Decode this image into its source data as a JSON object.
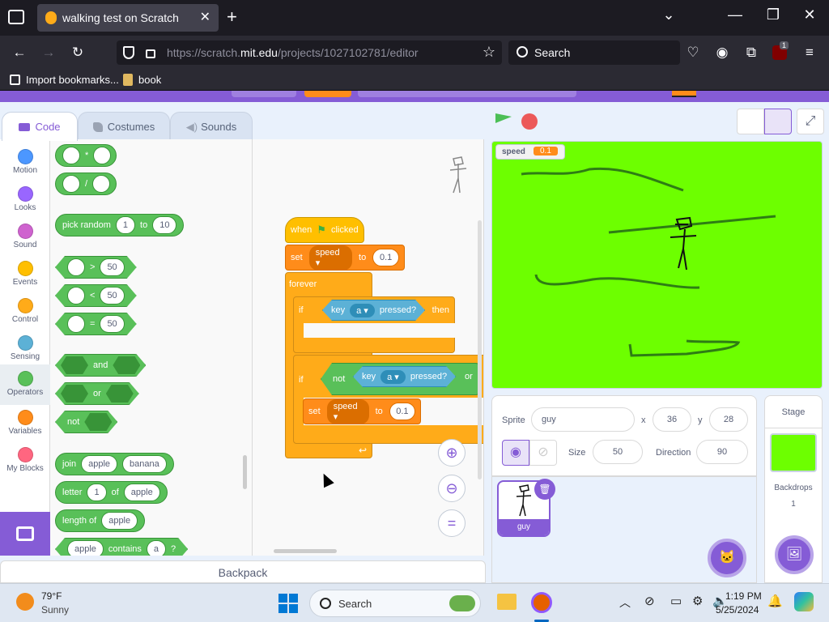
{
  "browser": {
    "tab_title": "walking test on Scratch",
    "tab_close": "✕",
    "new_tab": "+",
    "url_prefix": "https://scratch.",
    "url_domain": "mit.edu",
    "url_path": "/projects/1027102781/editor",
    "search_label": "Search",
    "extension_badge": "1",
    "bookmarks": [
      "Import bookmarks...",
      "book"
    ]
  },
  "scratch": {
    "tabs": [
      "Code",
      "Costumes",
      "Sounds"
    ],
    "categories": [
      {
        "label": "Motion",
        "color": "#4c97ff"
      },
      {
        "label": "Looks",
        "color": "#9966ff"
      },
      {
        "label": "Sound",
        "color": "#cf63cf"
      },
      {
        "label": "Events",
        "color": "#ffbf00"
      },
      {
        "label": "Control",
        "color": "#ffab19"
      },
      {
        "label": "Sensing",
        "color": "#5cb1d6"
      },
      {
        "label": "Operators",
        "color": "#59c059"
      },
      {
        "label": "Variables",
        "color": "#ff8c1a"
      },
      {
        "label": "My Blocks",
        "color": "#ff6680"
      }
    ],
    "palette": {
      "multiply": "*",
      "divide": "/",
      "pick_random": "pick random",
      "random_from": "1",
      "to": "to",
      "random_to": "10",
      "gt": ">",
      "lt": "<",
      "eq": "=",
      "cmp_value": "50",
      "and": "and",
      "or": "or",
      "not": "not",
      "join": "join",
      "join_a": "apple",
      "join_b": "banana",
      "letter": "letter",
      "letter_n": "1",
      "of": "of",
      "letter_word": "apple",
      "length_of": "length of",
      "length_word": "apple",
      "contains_word": "apple",
      "contains": "contains",
      "contains_letter": "a",
      "contains_q": "?"
    },
    "script": {
      "when": "when",
      "clicked": "clicked",
      "set": "set",
      "var_name": "speed",
      "to": "to",
      "value": "0.1",
      "forever": "forever",
      "if": "if",
      "then": "then",
      "key": "key",
      "key_name": "a",
      "pressed": "pressed?",
      "not": "not",
      "or": "or",
      "set2": "set",
      "var_name2": "speed",
      "to2": "to",
      "value2": "0.1"
    },
    "zoom": {
      "in": "+",
      "out": "−",
      "reset": "="
    },
    "backpack": "Backpack",
    "monitor": {
      "name": "speed",
      "value": "0.1"
    },
    "sprite": {
      "label": "Sprite",
      "name": "guy",
      "x_label": "x",
      "x": "36",
      "y_label": "y",
      "y": "28",
      "show_label": "Show",
      "size_label": "Size",
      "size": "50",
      "direction_label": "Direction",
      "direction": "90",
      "thumb_name": "guy"
    },
    "stage_pane": {
      "title": "Stage",
      "backdrops_label": "Backdrops",
      "backdrops_count": "1"
    }
  },
  "taskbar": {
    "temp": "79°F",
    "weather": "Sunny",
    "search": "Search",
    "time": "1:19 PM",
    "date": "5/25/2024"
  }
}
